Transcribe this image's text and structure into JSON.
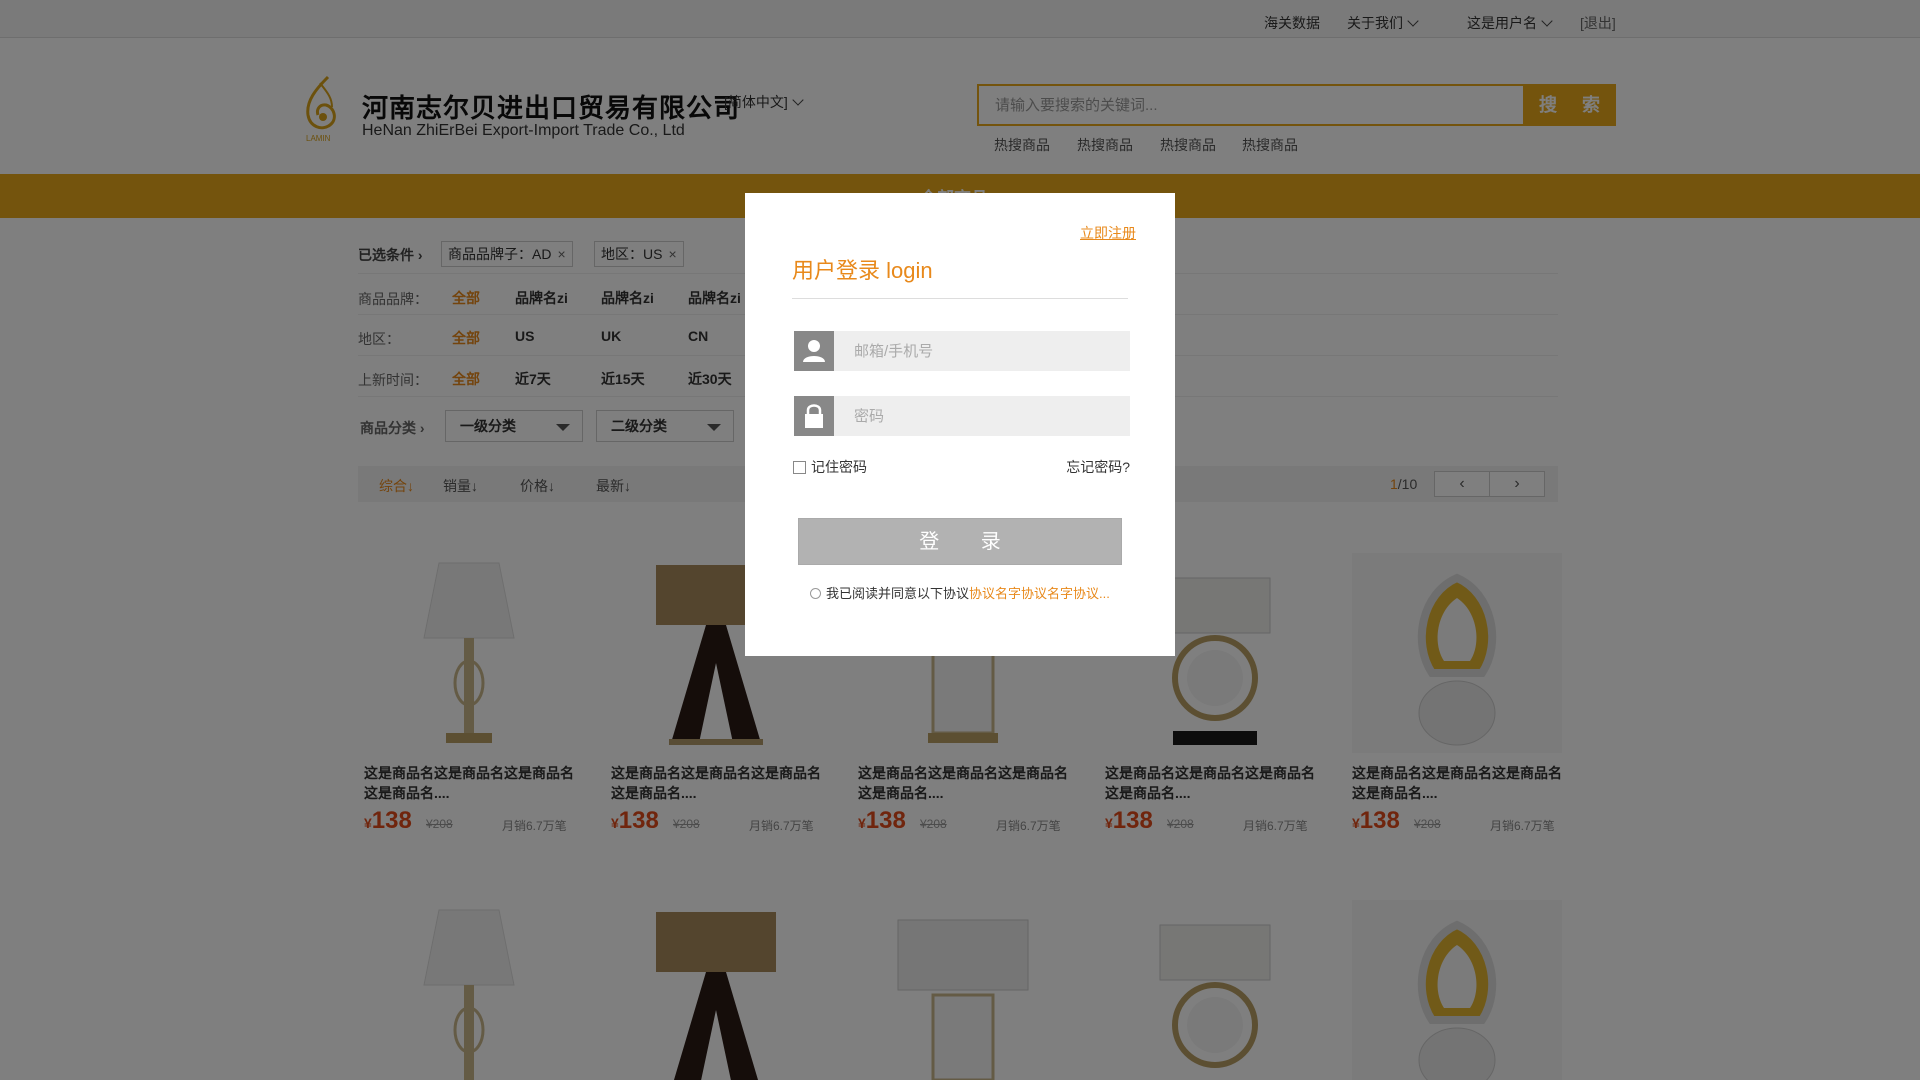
{
  "topbar": {
    "links": [
      "海关数据",
      "关于我们"
    ],
    "username": "这是用户名",
    "logout": "[退出]"
  },
  "header": {
    "company_cn": "河南志尔贝进出口贸易有限公司",
    "company_en": "HeNan ZhiErBei Export-Import Trade Co., Ltd",
    "language": "[简体中文]",
    "search_placeholder": "请输入要搜索的关键词...",
    "search_button": "搜 索",
    "hot_keywords": [
      "热搜商品",
      "热搜商品",
      "热搜商品",
      "热搜商品"
    ]
  },
  "nav": {
    "all_products": "全部商品"
  },
  "filters": {
    "selected_label": "已选条件",
    "selected_tags": [
      "商品品牌子：AD",
      "地区：US"
    ],
    "brand": {
      "label": "商品品牌：",
      "options": [
        "全部",
        "品牌名zi",
        "品牌名zi",
        "品牌名zi"
      ]
    },
    "region": {
      "label": "地区：",
      "options": [
        "全部",
        "US",
        "UK",
        "CN"
      ]
    },
    "new_time": {
      "label": "上新时间：",
      "options": [
        "全部",
        "近7天",
        "近15天",
        "近30天"
      ]
    },
    "category": {
      "label": "商品分类",
      "level1": "一级分类",
      "level2": "二级分类"
    }
  },
  "sortbar": {
    "items": [
      "综合",
      "销量",
      "价格",
      "最新"
    ],
    "active": "综合",
    "page_current": "1",
    "page_total": "/10"
  },
  "products": [
    {
      "name": "这是商品名这是商品名这是商品名这是商品名....",
      "price": "138",
      "original_price": "¥208",
      "sales": "月销6.7万笔",
      "image": "crystal-lamp"
    },
    {
      "name": "这是商品名这是商品名这是商品名这是商品名....",
      "price": "138",
      "original_price": "¥208",
      "sales": "月销6.7万笔",
      "image": "arch-lamp"
    },
    {
      "name": "这是商品名这是商品名这是商品名这是商品名....",
      "price": "138",
      "original_price": "¥208",
      "sales": "月销6.7万笔",
      "image": "glass-lamp"
    },
    {
      "name": "这是商品名这是商品名这是商品名这是商品名....",
      "price": "138",
      "original_price": "¥208",
      "sales": "月销6.7万笔",
      "image": "ring-lamp"
    },
    {
      "name": "这是商品名这是商品名这是商品名这是商品名....",
      "price": "138",
      "original_price": "¥208",
      "sales": "月销6.7万笔",
      "image": "sculpture-lamp"
    }
  ],
  "currency_symbol": "¥",
  "login_modal": {
    "register_link": "立即注册",
    "title": "用户登录 login",
    "username_placeholder": "邮箱/手机号",
    "password_placeholder": "密码",
    "remember": "记住密码",
    "forgot": "忘记密码?",
    "login_button": "登 录",
    "agree_text": "我已阅读并同意以下协议",
    "agreement_link": "协议名字协议名字协议..."
  },
  "colors": {
    "accent": "#e8a91b",
    "price": "#e04a1a",
    "link": "#e8891b"
  }
}
